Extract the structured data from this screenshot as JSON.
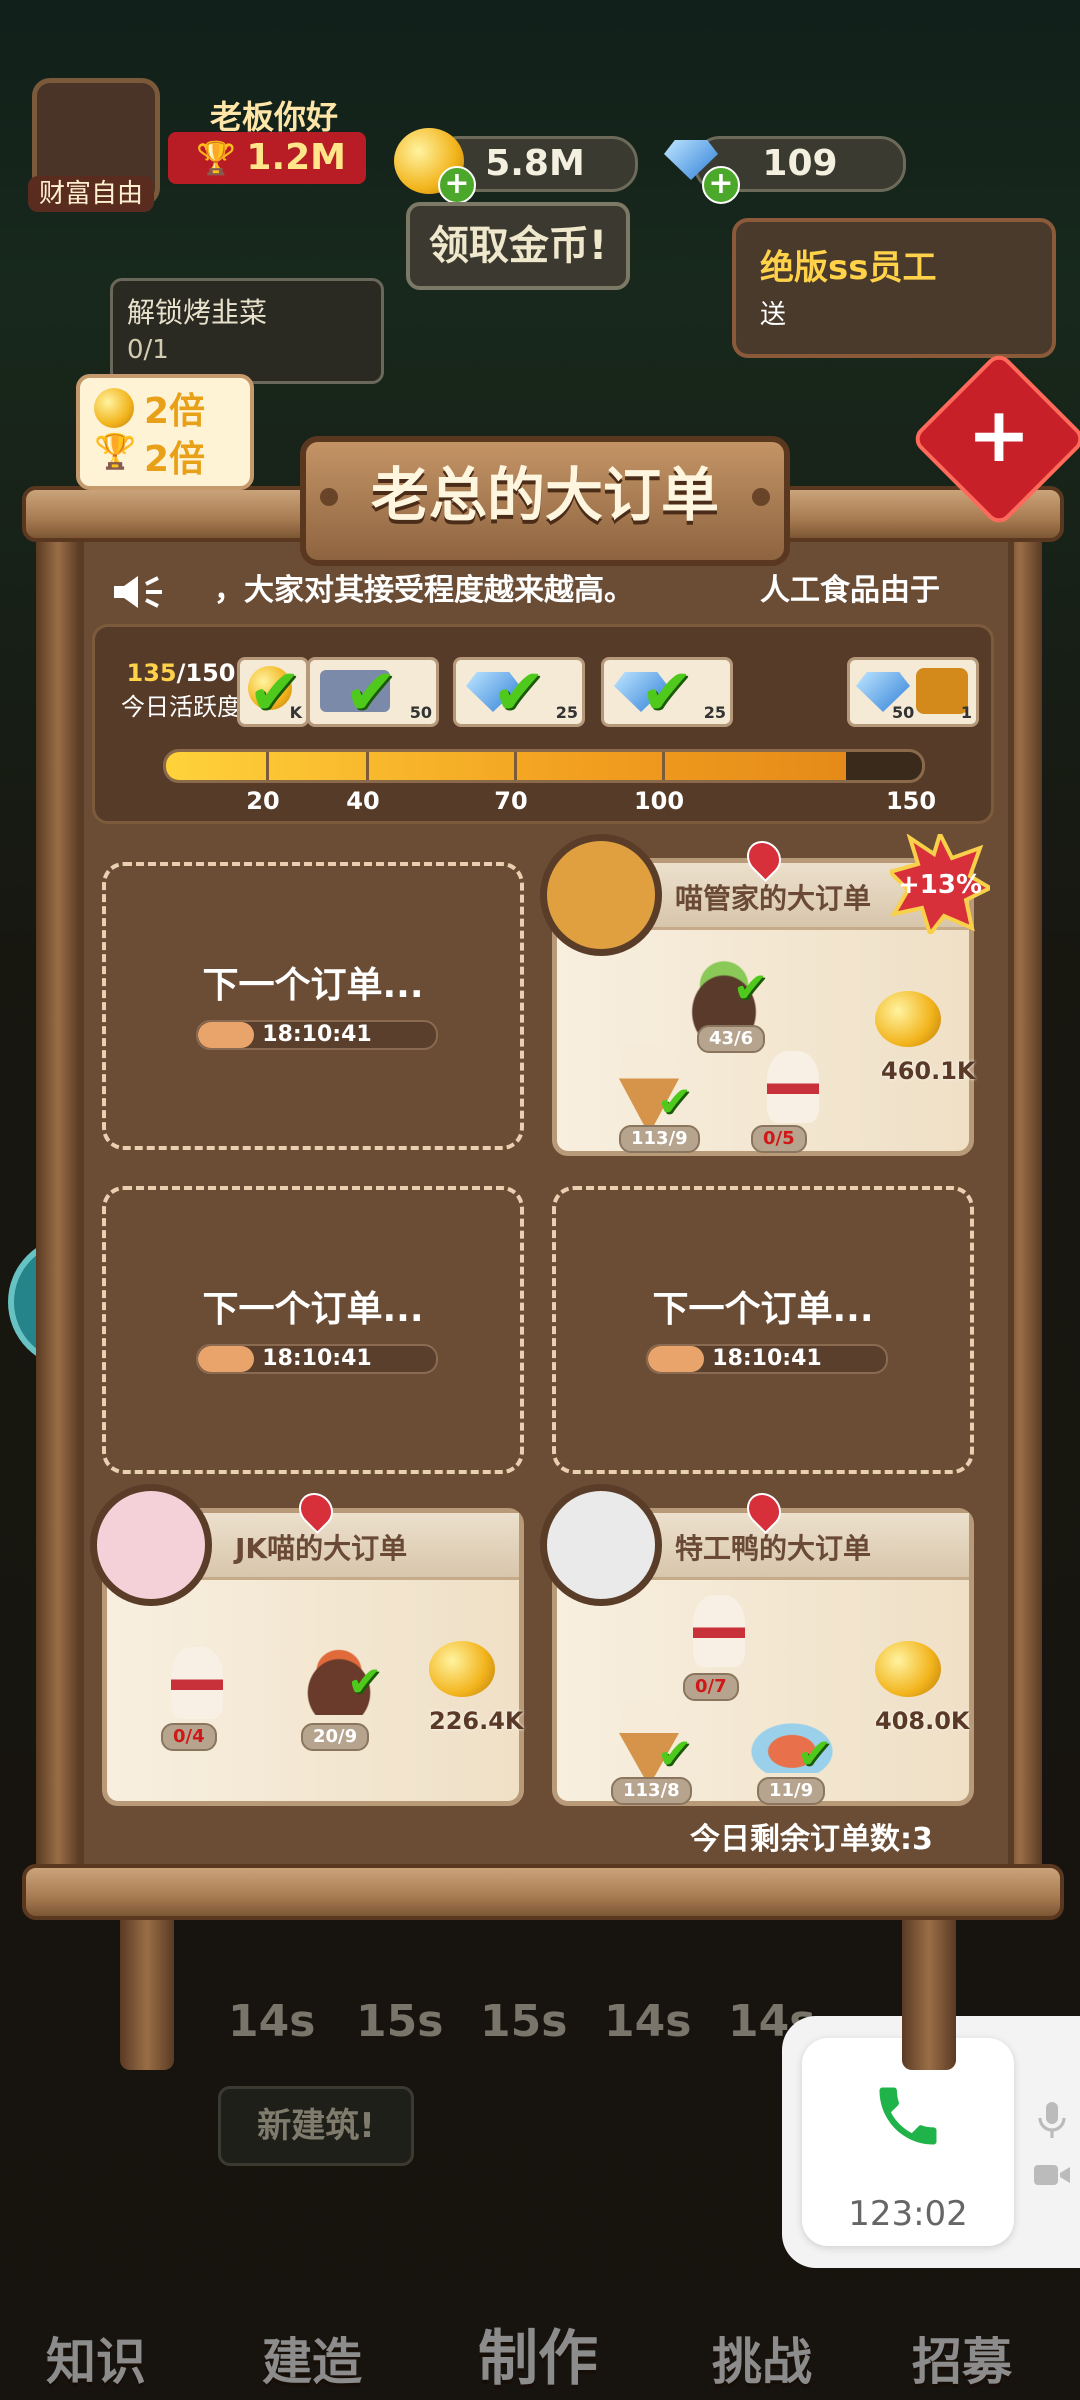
{
  "hud": {
    "avatar_caption": "财富自由",
    "greeting": "老板你好",
    "trophy_value": "1.2M",
    "coins": "5.8M",
    "gems": "109",
    "claim_button": "领取金币!",
    "promo_title": "绝版ss员工",
    "promo_sub": "送",
    "unlock_task": "解锁烤韭菜",
    "unlock_progress": "0/1",
    "coin_multiplier": "2倍",
    "trophy_multiplier": "2倍"
  },
  "board": {
    "title": "老总的大订单",
    "news_left": "，大家对其接受程度越来越高。",
    "news_right": "人工食品由于",
    "activity": {
      "current": "135",
      "max": "/150",
      "label": "今日活跃度",
      "progress": 0.9,
      "milestones": [
        "20",
        "40",
        "70",
        "100",
        "150"
      ],
      "reward_badges": [
        "K",
        "50",
        "25",
        "25",
        "50",
        "1"
      ]
    },
    "slots": [
      {
        "title": "下一个订单...",
        "timer": "18:10:41"
      },
      {
        "title": "下一个订单...",
        "timer": "18:10:41"
      },
      {
        "title": "下一个订单...",
        "timer": "18:10:41"
      }
    ],
    "orders": [
      {
        "name": "喵管家的大订单",
        "bonus": "+13%",
        "items": [
          "43/6",
          "113/9",
          "0/5"
        ],
        "reward": "460.1K"
      },
      {
        "name": "JK喵的大订单",
        "items": [
          "0/4",
          "20/9"
        ],
        "reward": "226.4K"
      },
      {
        "name": "特工鸭的大订单",
        "items": [
          "0/7",
          "113/8",
          "11/9"
        ],
        "reward": "408.0K"
      }
    ],
    "remaining": "今日剩余订单数:3"
  },
  "background": {
    "timers": [
      "14s",
      "15s",
      "15s",
      "14s",
      "14s"
    ],
    "build_tip": "新建筑!",
    "tabs": [
      "知识",
      "建造",
      "制作",
      "挑战",
      "招募"
    ]
  },
  "call": {
    "duration": "123:02"
  },
  "colors": {
    "accent_green": "#4fca1c",
    "bonus_red": "#d8303a",
    "bar_fill": "#f2a020"
  }
}
